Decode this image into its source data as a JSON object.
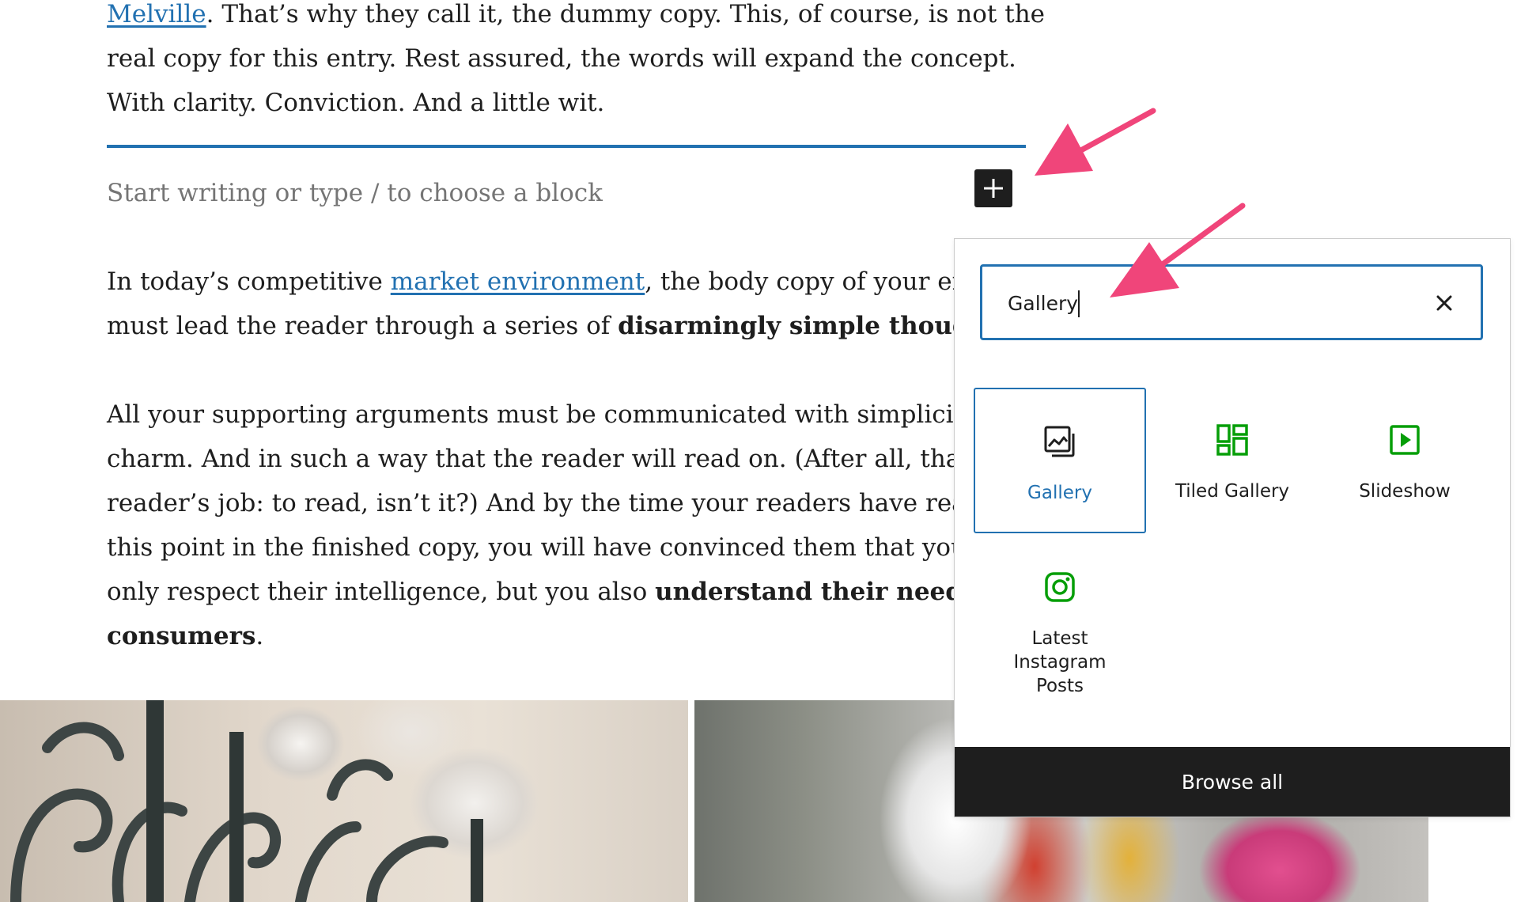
{
  "content": {
    "intro": {
      "link": "Melville",
      "line1_rest": ". That’s why they call it, the dummy copy. This, of course, is not the",
      "line2": "real copy for this entry. Rest assured, the words will expand the concept.",
      "line3": "With clarity. Conviction. And a little wit."
    },
    "placeholder": "Start writing or type / to choose a block",
    "para2": {
      "prefix": "In today’s competitive ",
      "link": "market environment",
      "rest1": ", the body copy of your entr",
      "line2_plain": "must lead the reader through a series of ",
      "line2_bold": "disarmingly simple thoughts"
    },
    "para3": {
      "line1": "All your supporting arguments must be communicated with simplicity",
      "line2": "charm. And in such a way that the reader will read on. (After all, that’s",
      "line3": "reader’s job: to read, isn’t it?) And by the time your readers have reach",
      "line4": "this point in the finished copy, you will have convinced them that you r",
      "line5_plain": "only respect their intelligence, but you also ",
      "line5_bold": "understand their needs a",
      "line6_bold": "consumers",
      "line6_end": "."
    }
  },
  "inserter": {
    "search_value": "Gallery",
    "results": [
      {
        "label": "Gallery",
        "icon": "gallery-icon",
        "selected": true
      },
      {
        "label": "Tiled Gallery",
        "icon": "tiled-gallery-icon",
        "selected": false
      },
      {
        "label": "Slideshow",
        "icon": "slideshow-icon",
        "selected": false
      },
      {
        "label": "Latest\nInstagram\nPosts",
        "icon": "instagram-icon",
        "selected": false
      }
    ],
    "browse_all_label": "Browse all"
  },
  "colors": {
    "accent": "#2271b1",
    "jetpack_green": "#069e08",
    "annotation_arrow": "#f0457a",
    "dark": "#1e1e1e"
  }
}
